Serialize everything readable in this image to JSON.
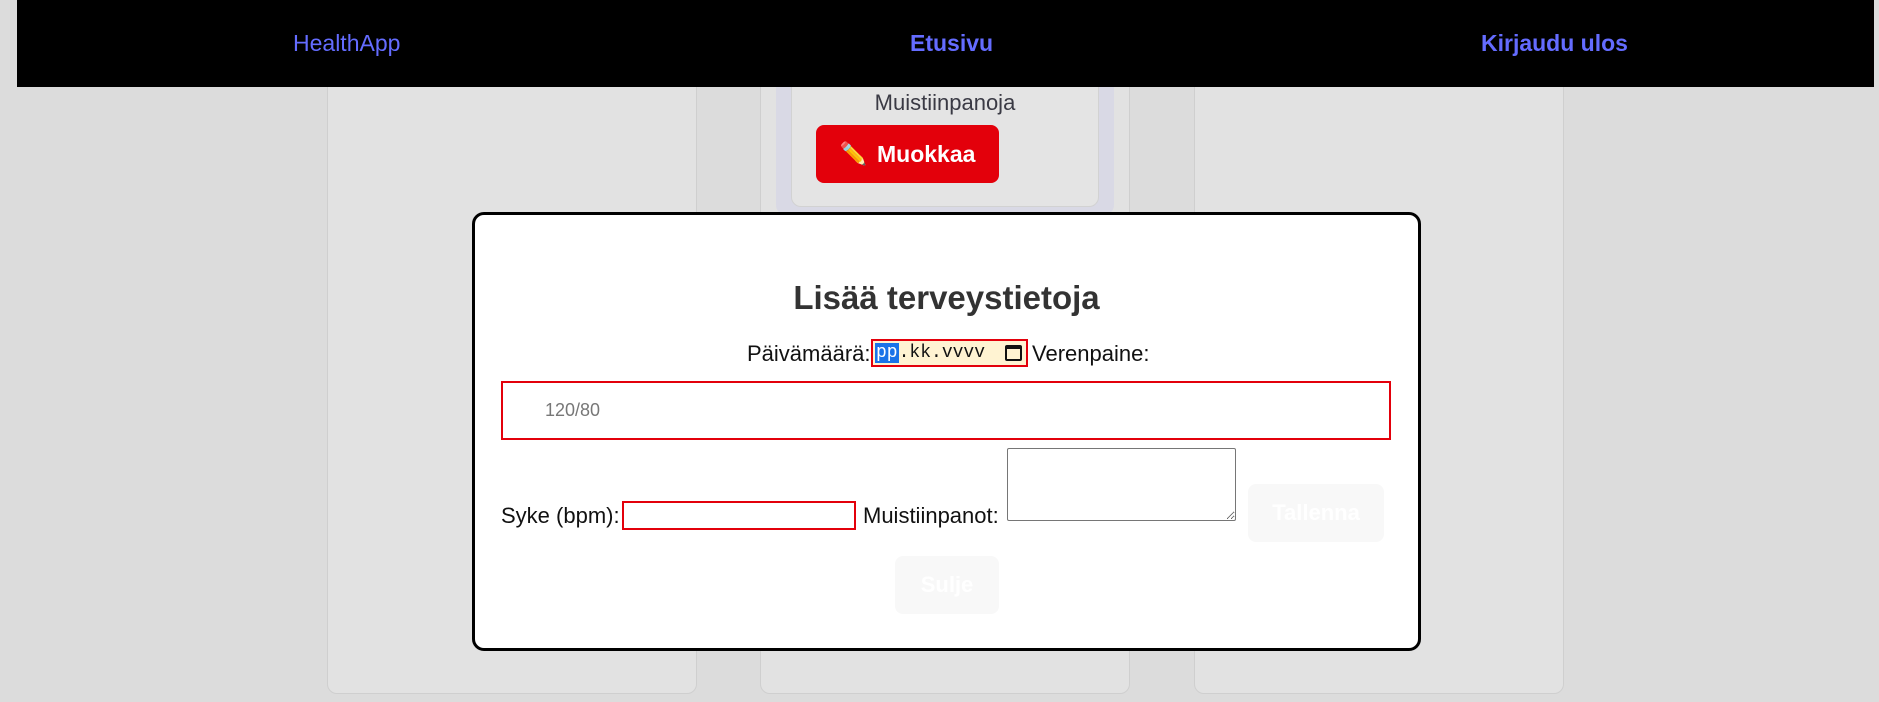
{
  "nav": {
    "brand": "HealthApp",
    "home": "Etusivu",
    "logout": "Kirjaudu ulos"
  },
  "card": {
    "notes_label": "Muistiinpanoja",
    "edit_label": "Muokkaa",
    "edit_icon": "pencil-icon"
  },
  "modal": {
    "title": "Lisää terveystietoja",
    "date_label": "Päivämäärä:",
    "date_placeholder": {
      "day": "pp",
      "rest": ".kk.vvvv"
    },
    "bp_label": "Verenpaine:",
    "bp_placeholder": "120/80",
    "hr_label": "Syke (bpm):",
    "notes_label": "Muistiinpanot:",
    "save_label": "Tallenna",
    "close_label": "Sulje"
  },
  "colors": {
    "accent": "#646cff",
    "danger": "#e3000b",
    "topbar": "#000000"
  }
}
